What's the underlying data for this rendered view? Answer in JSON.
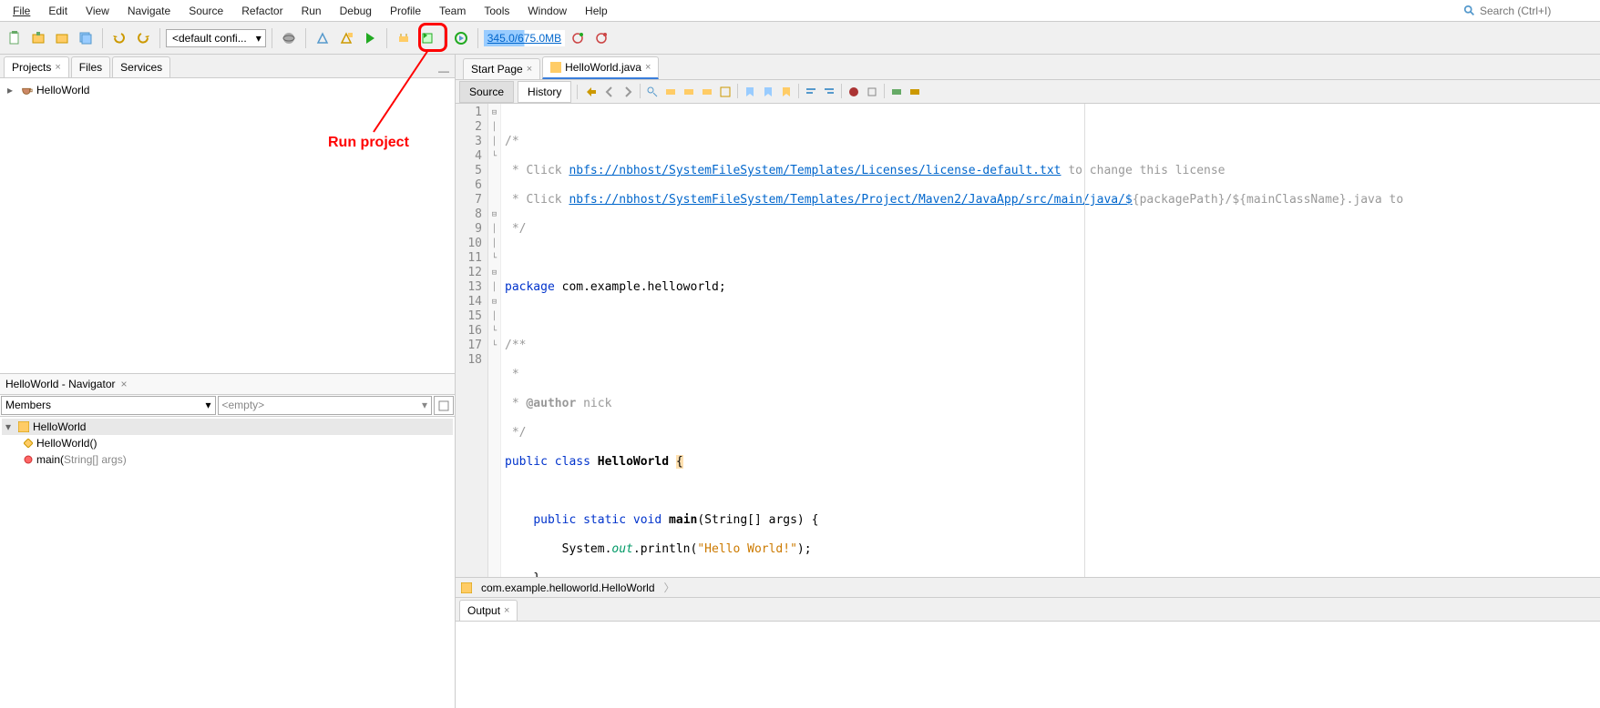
{
  "menu": [
    "File",
    "Edit",
    "View",
    "Navigate",
    "Source",
    "Refactor",
    "Run",
    "Debug",
    "Profile",
    "Team",
    "Tools",
    "Window",
    "Help"
  ],
  "search_placeholder": "Search (Ctrl+I)",
  "toolbar": {
    "config": "<default confi...",
    "memory": "345.0/675.0MB"
  },
  "annotation": "Run project",
  "projects": {
    "tabs": [
      "Projects",
      "Files",
      "Services"
    ],
    "root": "HelloWorld"
  },
  "navigator": {
    "title": "HelloWorld - Navigator",
    "filter": "Members",
    "filter2": "<empty>",
    "root": "HelloWorld",
    "items": [
      {
        "icon": "diamond",
        "label": "HelloWorld()",
        "grey": ""
      },
      {
        "icon": "circle",
        "label": "main(",
        "grey": "String[] args)"
      }
    ]
  },
  "editor": {
    "tabs": [
      {
        "label": "Start Page",
        "active": false
      },
      {
        "label": "HelloWorld.java",
        "active": true,
        "icon": "java"
      }
    ],
    "subtabs": [
      "Source",
      "History"
    ],
    "breadcrumb": "com.example.helloworld.HelloWorld",
    "code": {
      "link1": "nbfs://nbhost/SystemFileSystem/Templates/Licenses/license-default.txt",
      "link2": "nbfs://nbhost/SystemFileSystem/Templates/Project/Maven2/JavaApp/src/main/java/$",
      "tail1": " to change this license",
      "tail2": "{packagePath}/${mainClassName}.java to",
      "package": "com.example.helloworld",
      "author": "nick",
      "classname": "HelloWorld",
      "method": "main",
      "params": "(String[] args) {",
      "println_str": "\"Hello World!\""
    }
  },
  "output": {
    "tab": "Output"
  }
}
